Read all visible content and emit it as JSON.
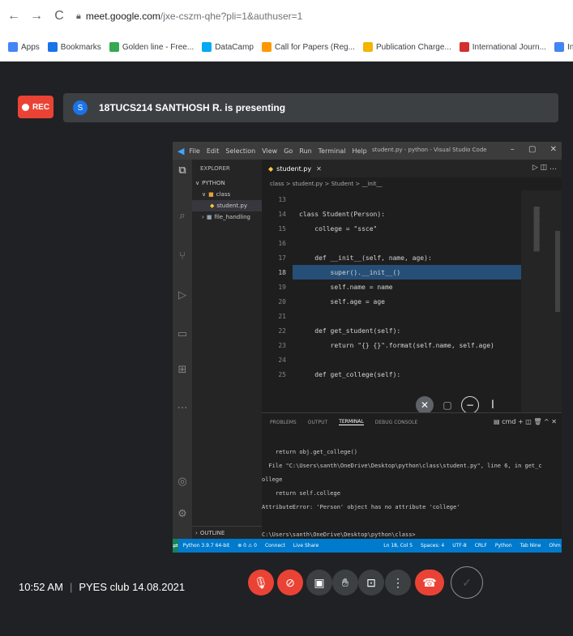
{
  "browser": {
    "url_host": "meet.google.com",
    "url_path": "/jxe-cszm-qhe?pli=1&authuser=1",
    "nav": {
      "back": "←",
      "forward": "→",
      "reload": "C"
    },
    "bookmarks": [
      {
        "label": "Apps",
        "icon": "apps-grid-icon",
        "color": "#4285f4"
      },
      {
        "label": "Bookmarks",
        "icon": "star-icon",
        "color": "#1a73e8"
      },
      {
        "label": "Golden line - Free...",
        "icon": "golden-line-icon",
        "color": "#34a853"
      },
      {
        "label": "DataCamp",
        "icon": "datacamp-icon",
        "color": "#03a9f4"
      },
      {
        "label": "Call for Papers (Reg...",
        "icon": "call-for-papers-icon",
        "color": "#ff9800"
      },
      {
        "label": "Publication Charge...",
        "icon": "publication-icon",
        "color": "#f4b400"
      },
      {
        "label": "International Journ...",
        "icon": "journal-icon",
        "color": "#d32f2f"
      },
      {
        "label": "International Journ...",
        "icon": "journal-icon-2",
        "color": "#4285f4"
      }
    ]
  },
  "meet": {
    "rec_label": "REC",
    "presenter_initial": "S",
    "presenter_text": "18TUCS214 SANTHOSH R. is presenting",
    "time": "10:52 AM",
    "meeting_name": "PYES club 14.08.2021"
  },
  "vscode": {
    "menu": [
      "File",
      "Edit",
      "Selection",
      "View",
      "Go",
      "Run",
      "Terminal",
      "Help"
    ],
    "window_title": "student.py - python - Visual Studio Code",
    "explorer_header": "EXPLORER",
    "tree": [
      {
        "label": "PYTHON"
      },
      {
        "label": "class"
      },
      {
        "label": "student.py"
      },
      {
        "label": "file_handling"
      }
    ],
    "outline_label": "OUTLINE",
    "tab_label": "student.py",
    "breadcrumb": "class > student.py > Student > __init__",
    "code_lines": [
      {
        "n": "13",
        "text": ""
      },
      {
        "n": "14",
        "text": "class Student(Person):"
      },
      {
        "n": "15",
        "text": "    college = \"ssce\""
      },
      {
        "n": "16",
        "text": ""
      },
      {
        "n": "17",
        "text": "    def __init__(self, name, age):"
      },
      {
        "n": "18",
        "text": "        super().__init__()"
      },
      {
        "n": "19",
        "text": "        self.name = name"
      },
      {
        "n": "20",
        "text": "        self.age = age"
      },
      {
        "n": "21",
        "text": ""
      },
      {
        "n": "22",
        "text": "    def get_student(self):"
      },
      {
        "n": "23",
        "text": "        return \"{} {}\".format(self.name, self.age)"
      },
      {
        "n": "24",
        "text": ""
      },
      {
        "n": "25",
        "text": "    def get_college(self):"
      }
    ],
    "panel_tabs": [
      "PROBLEMS",
      "OUTPUT",
      "TERMINAL",
      "DEBUG CONSOLE"
    ],
    "panel_shell": "cmd",
    "terminal_lines": [
      "    return obj.get_college()",
      "  File \"C:\\Users\\santh\\OneDrive\\Desktop\\python\\class\\student.py\", line 6, in get_c",
      "ollege",
      "    return self.college",
      "AttributeError: 'Person' object has no attribute 'college'",
      "",
      "C:\\Users\\santh\\OneDrive\\Desktop\\python\\class>"
    ],
    "status_items": [
      "Python 3.9.7 64-bit",
      "⊗ 0 ⚠ 0",
      "Connect",
      "Live Share",
      "Ln 18, Col 5",
      "Spaces: 4",
      "UTF-8",
      "CRLF",
      "Python",
      "Tab Nine",
      "Ohm"
    ]
  }
}
